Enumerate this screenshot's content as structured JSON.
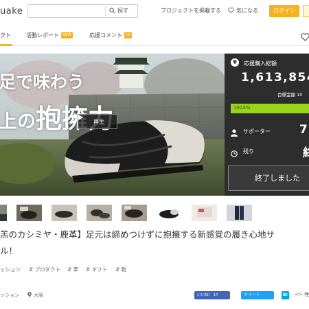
{
  "header": {
    "logo": "uake",
    "search_placeholder": "",
    "search_label": "探す",
    "post_project": "プロジェクトを掲載する",
    "favorites": "気になる",
    "login": "ログイン"
  },
  "tabs": [
    {
      "label": "クト"
    },
    {
      "label": "活動レポート",
      "badge": "NEW"
    },
    {
      "label": "応援コメント",
      "badge": "10"
    }
  ],
  "hero": {
    "line1": "足で味わう",
    "line2_prefix": "上の",
    "line2_big": "抱擁力",
    "play": "再生"
  },
  "panel": {
    "funded_label": "応援購入総額",
    "amount": "1,613,854",
    "goal": "目標金額 10",
    "progress_text": "1613%",
    "progress_percent": 1613,
    "supporters_label": "サポーター",
    "supporters_value": "7",
    "remaining_label": "残り",
    "remaining_value": "終",
    "ended": "終了しました"
  },
  "thumbnails": [
    "thumb-1",
    "thumb-2",
    "thumb-3",
    "thumb-4",
    "thumb-5",
    "thumb-6",
    "thumb-7",
    "thumb-8",
    "thumb-9"
  ],
  "project": {
    "title_line1": "羔のカシミヤ・鹿革】足元は締めつけずに抱擁する新感覚の履き心地サ",
    "title_line2": "ル！"
  },
  "tags": [
    "ッション",
    "# プロダクト",
    "# 革",
    "# ギフト",
    "# 靴"
  ],
  "footer": {
    "category": "ッション",
    "location": "大阪",
    "fb_like": "いいね！ 17",
    "tweet": "ツイート",
    "hatena": "B!",
    "share": "<> 埋"
  },
  "colors": {
    "accent": "#f6b321",
    "panel_bg": "#2d2d2d",
    "progress": "#9bd31b",
    "facebook": "#4267b2",
    "twitter": "#1da1f2"
  }
}
